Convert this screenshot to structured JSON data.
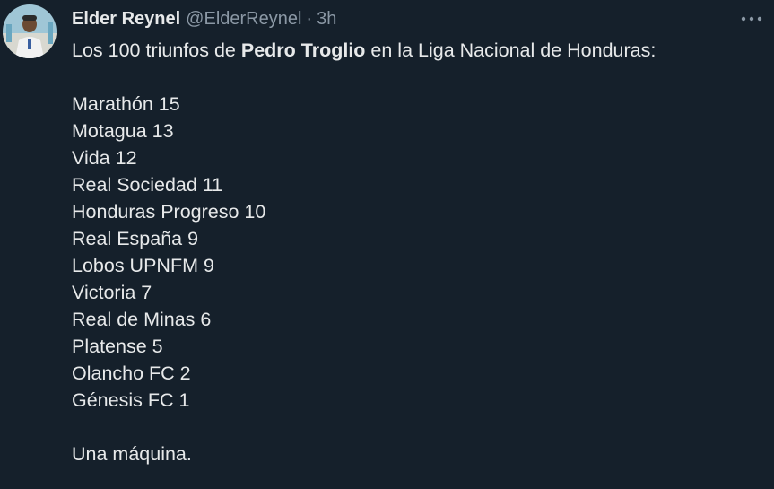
{
  "author": {
    "name": "Elder Reynel",
    "handle": "@ElderReynel",
    "separator": "·",
    "time": "3h",
    "avatar_icon": "profile-photo"
  },
  "more_icon": "more-horizontal-icon",
  "tweet": {
    "intro_before": "Los 100 triunfos de ",
    "intro_bold": "Pedro Troglio",
    "intro_after": " en la Liga Nacional de Honduras:",
    "list": [
      "Marathón 15",
      "Motagua 13",
      "Vida 12",
      "Real Sociedad 11",
      "Honduras Progreso 10",
      "Real España 9",
      "Lobos UPNFM 9",
      "Victoria 7",
      "Real de Minas 6",
      "Platense 5",
      "Olancho FC 2",
      "Génesis FC 1"
    ],
    "closing": "Una máquina."
  },
  "colors": {
    "background": "#15202b",
    "text": "#e7e9ea",
    "secondary": "#8b98a5"
  }
}
